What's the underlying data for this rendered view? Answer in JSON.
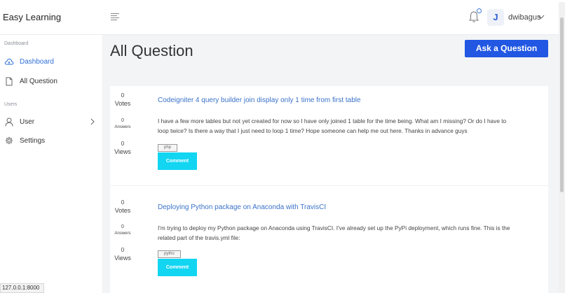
{
  "header": {
    "brand": "Easy Learning",
    "user_initial": "J",
    "username": "dwibagus"
  },
  "sidebar": {
    "sections": [
      {
        "label": "Dashboard",
        "items": [
          {
            "label": "Dashboard",
            "icon": "cloud-icon",
            "active": true
          },
          {
            "label": "All Question",
            "icon": "document-icon",
            "active": false
          }
        ]
      },
      {
        "label": "Users",
        "items": [
          {
            "label": "User",
            "icon": "person-icon",
            "has_chevron": true
          },
          {
            "label": "Settings",
            "icon": "gear-icon"
          }
        ]
      }
    ]
  },
  "main": {
    "title": "All Question",
    "ask_button": "Ask a Question",
    "questions": [
      {
        "votes": "0",
        "votes_label": "Votes",
        "answers": "0",
        "answers_label": "Answers",
        "views": "0",
        "views_label": "Views",
        "title": "Codeigniter 4 query builder join display only 1 time from first table",
        "body_line1": "I have a few more tables but not yet created for now so I have only joined 1 table for the time being. What am I missing? Or do I have to",
        "body_line2": "loop twice? Is there a way that I just need to loop 1 time? Hope someone can help me out here. Thanks in advance guys",
        "tag": "php",
        "comment_button": "Comment"
      },
      {
        "votes": "0",
        "votes_label": "Votes",
        "answers": "0",
        "answers_label": "Answers",
        "views": "0",
        "views_label": "Views",
        "title": "Deploying Python package on Anaconda with TravisCI",
        "body_line1": "I'm trying to deploy my Python package on Anaconda using TravisCI. I've already set up the PyPi deployment, which runs fine. This is the",
        "body_line2": "related part of the travis.yml file:",
        "tag": "pytho",
        "comment_button": "Comment"
      }
    ]
  },
  "status_bar": {
    "url": "127.0.0.1:8000"
  },
  "colors": {
    "primary": "#2157e2",
    "accent": "#12d5f2",
    "link": "#3a72c8"
  }
}
